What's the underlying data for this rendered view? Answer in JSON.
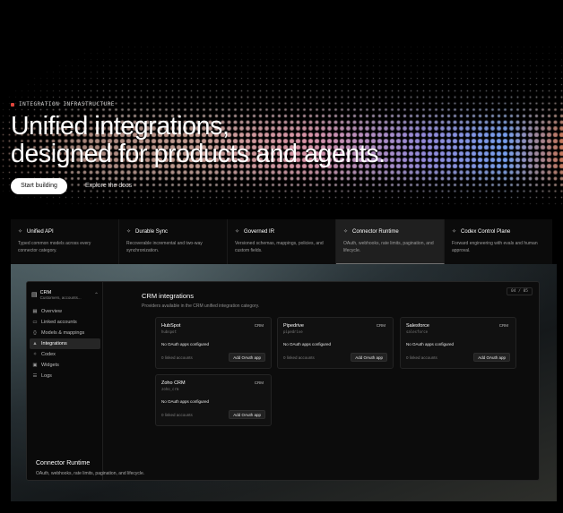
{
  "hero": {
    "eyebrow": "INTEGRATION INFRASTRUCTURE",
    "headline_line1": "Unified integrations,",
    "headline_line2": "designed for products and agents.",
    "primary_button": "Start building",
    "secondary_link": "Explore the docs"
  },
  "features": [
    {
      "title": "Unified API",
      "desc": "Typed common models across every connector category.",
      "icon": "sparkle-icon"
    },
    {
      "title": "Durable Sync",
      "desc": "Recoverable incremental and two-way synchronization.",
      "icon": "sparkle-icon"
    },
    {
      "title": "Governed IR",
      "desc": "Versioned schemas, mappings, policies, and custom fields.",
      "icon": "sparkle-icon"
    },
    {
      "title": "Connector Runtime",
      "desc": "OAuth, webhooks, rate limits, pagination, and lifecycle.",
      "icon": "sparkle-icon",
      "active": true
    },
    {
      "title": "Codex Control Plane",
      "desc": "Forward engineering with evals and human approval.",
      "icon": "sparkle-icon"
    }
  ],
  "app": {
    "workspace": {
      "title": "CRM",
      "subtitle": "Customers, accounts..."
    },
    "nav": [
      {
        "label": "Overview",
        "icon": "grid-icon"
      },
      {
        "label": "Linked accounts",
        "icon": "link-icon"
      },
      {
        "label": "Models & mappings",
        "icon": "braces-icon"
      },
      {
        "label": "Integrations",
        "icon": "plug-icon",
        "active": true
      },
      {
        "label": "Codex",
        "icon": "sparkle-icon"
      },
      {
        "label": "Widgets",
        "icon": "widget-icon"
      },
      {
        "label": "Logs",
        "icon": "log-icon"
      }
    ],
    "page_title": "CRM integrations",
    "page_subtitle": "Providers available in the CRM unified integration category.",
    "page_indicator": "04 / 05",
    "cards": [
      {
        "name": "HubSpot",
        "slug": "hubspot",
        "category": "CRM",
        "status": "No OAuth apps configured",
        "count": "0 linked accounts",
        "button": "Add OAuth app"
      },
      {
        "name": "Pipedrive",
        "slug": "pipedrive",
        "category": "CRM",
        "status": "No OAuth apps configured",
        "count": "0 linked accounts",
        "button": "Add OAuth app"
      },
      {
        "name": "Salesforce",
        "slug": "salesforce",
        "category": "CRM",
        "status": "No OAuth apps configured",
        "count": "0 linked accounts",
        "button": "Add OAuth app"
      },
      {
        "name": "Zoho CRM",
        "slug": "zoho_crm",
        "category": "CRM",
        "status": "No OAuth apps configured",
        "count": "0 linked accounts",
        "button": "Add OAuth app"
      }
    ],
    "caption_title": "Connector Runtime",
    "caption_desc": "OAuth, webhooks, rate limits, pagination, and lifecycle."
  },
  "colors": {
    "accent_red": "#e0463c",
    "background": "#000000"
  }
}
